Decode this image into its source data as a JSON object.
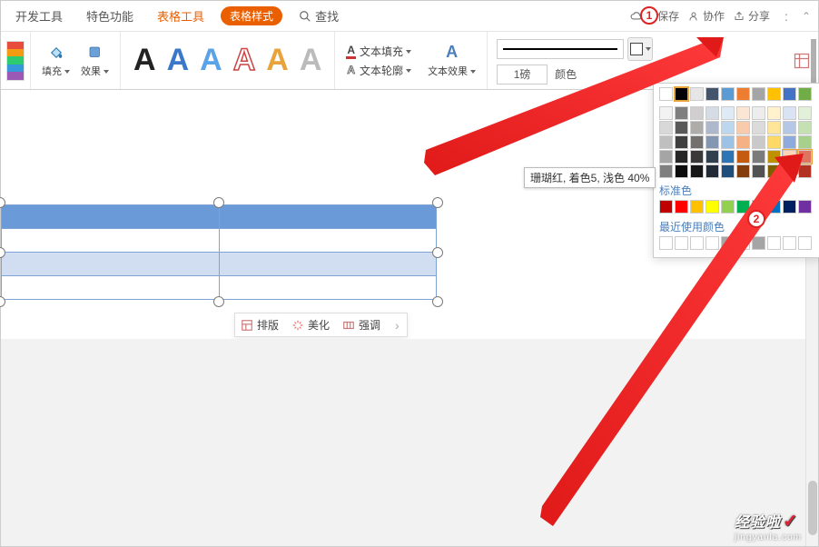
{
  "tabs": {
    "dev": "开发工具",
    "special": "特色功能",
    "table_tools": "表格工具",
    "table_style": "表格样式",
    "find": "查找"
  },
  "topright": {
    "unsaved": "未保存",
    "collab": "协作",
    "share": "分享"
  },
  "ribbon": {
    "fill": "填充",
    "effect": "效果",
    "text_fill": "文本填充",
    "text_outline": "文本轮廓",
    "text_effect": "文本效果",
    "weight_label": "1磅",
    "color_label": "颜色"
  },
  "floatbar": {
    "layout": "排版",
    "beautify": "美化",
    "emphasis": "强调"
  },
  "popup": {
    "tooltip": "珊瑚红, 着色5, 浅色 40%",
    "standard": "标准色",
    "recent": "最近使用颜色",
    "theme_row": [
      "#ffffff",
      "#000000",
      "#e7e6e6",
      "#44546a",
      "#5b9bd5",
      "#ed7d31",
      "#a5a5a5",
      "#ffc000",
      "#4472c4",
      "#70ad47"
    ],
    "shades": [
      [
        "#f2f2f2",
        "#7f7f7f",
        "#d0cece",
        "#d6dce4",
        "#deebf6",
        "#fbe5d5",
        "#ededed",
        "#fff2cc",
        "#dae3f3",
        "#e2efd9"
      ],
      [
        "#d8d8d8",
        "#595959",
        "#aeabab",
        "#adb9ca",
        "#bdd7ee",
        "#f7cbac",
        "#dbdbdb",
        "#fee599",
        "#b4c7e7",
        "#c5e0b3"
      ],
      [
        "#bfbfbf",
        "#3f3f3f",
        "#757070",
        "#8496b0",
        "#9cc3e5",
        "#f4b183",
        "#c9c9c9",
        "#ffd965",
        "#8faadc",
        "#a8d08d"
      ],
      [
        "#a5a5a5",
        "#262626",
        "#3a3838",
        "#323f4f",
        "#2e75b5",
        "#c55a11",
        "#7b7b7b",
        "#bf9000",
        "#ffd3b5",
        "#e0735f"
      ],
      [
        "#7f7f7f",
        "#0c0c0c",
        "#171616",
        "#222a35",
        "#1e4e79",
        "#833c0b",
        "#525252",
        "#7f6000",
        "#e88e51",
        "#b33322"
      ]
    ],
    "standard_colors": [
      "#c00000",
      "#ff0000",
      "#ffc000",
      "#ffff00",
      "#92d050",
      "#00b050",
      "#00b0f0",
      "#0070c0",
      "#002060",
      "#7030a0"
    ],
    "recent_colors": [
      "#ffffff",
      "#ffffff",
      "#ffffff",
      "#ffffff",
      "#a5a5a5",
      "#ffffff",
      "#a5a5a5",
      "#ffffff",
      "#ffffff",
      "#ffffff"
    ]
  },
  "watermark": {
    "brand": "经验啦",
    "url": "jingyanla.com"
  },
  "annotations": {
    "one": "1",
    "two": "2"
  }
}
